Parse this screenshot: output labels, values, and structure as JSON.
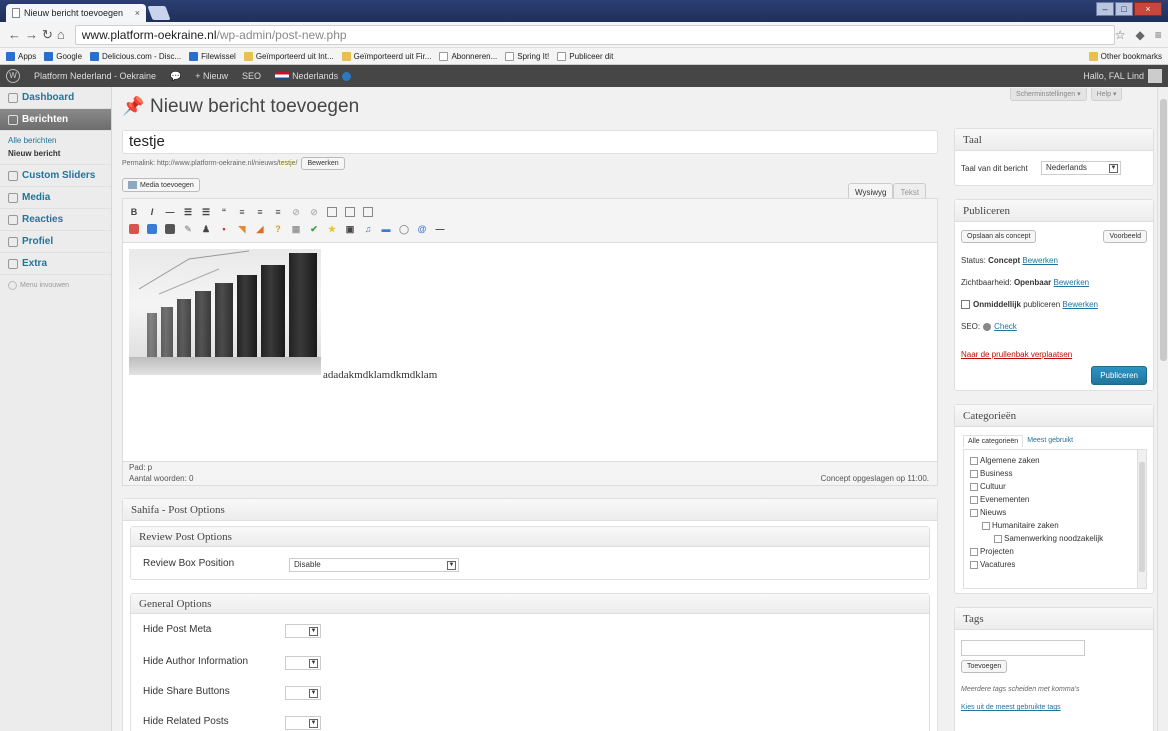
{
  "browser": {
    "tab_title": "Nieuw bericht toevoegen",
    "tab_close": "×",
    "url_host": "www.platform-oekraine.nl",
    "url_path": "/wp-admin/post-new.php",
    "bookmarks": [
      {
        "label": "Apps",
        "icon": "apps-icon"
      },
      {
        "label": "Google",
        "icon": "google-icon"
      },
      {
        "label": "Delicious.com - Disc...",
        "icon": "delicious-icon"
      },
      {
        "label": "Filewissel",
        "icon": "filewissel-icon"
      },
      {
        "label": "Geïmporteerd uit Int...",
        "icon": "folder-icon"
      },
      {
        "label": "Geïmporteerd uit Fir...",
        "icon": "folder-icon"
      },
      {
        "label": "Abonneren...",
        "icon": "page-icon"
      },
      {
        "label": "Spring It!",
        "icon": "page-icon"
      },
      {
        "label": "Publiceer dit",
        "icon": "page-icon"
      }
    ],
    "other_bookmarks": "Other bookmarks"
  },
  "adminbar": {
    "site": "Platform Nederland - Oekraine",
    "new": "+ Nieuw",
    "seo": "SEO",
    "language": "Nederlands",
    "howdy": "Hallo, FAL Lind"
  },
  "menu": {
    "dashboard": "Dashboard",
    "berichten": "Berichten",
    "alle": "Alle berichten",
    "nieuw": "Nieuw bericht",
    "sliders": "Custom Sliders",
    "media": "Media",
    "reacties": "Reacties",
    "profiel": "Profiel",
    "extra": "Extra",
    "collapse": "Menu invouwen"
  },
  "screen_options": "Scherminstellingen ▾",
  "help": "Help ▾",
  "page_title": "Nieuw bericht toevoegen",
  "post": {
    "title": "testje",
    "permalink_prefix": "Permalink: http://www.platform-oekraine.nl/nieuws/",
    "slug": "testje",
    "permalink_suffix": "/",
    "edit_btn": "Bewerken",
    "media_btn": "Media toevoegen",
    "tab_visual": "Wysiwyg",
    "tab_text": "Tekst",
    "content_text": "adadakmdklamdkmdklam",
    "path": "Pad: p",
    "word_count": "Aantal woorden: 0",
    "saved": "Concept opgeslagen op 11:00."
  },
  "sahifa": {
    "title": "Sahifa - Post Options",
    "review_title": "Review Post Options",
    "review_label": "Review Box Position",
    "review_value": "Disable",
    "general_title": "General Options",
    "options": [
      "Hide Post Meta",
      "Hide Author Information",
      "Hide Share Buttons",
      "Hide Related Posts"
    ]
  },
  "taal": {
    "title": "Taal",
    "label": "Taal van dit bericht",
    "value": "Nederlands"
  },
  "publish": {
    "title": "Publiceren",
    "save_draft": "Opslaan als concept",
    "preview": "Voorbeeld",
    "status_label": "Status:",
    "status_value": "Concept",
    "status_edit": "Bewerken",
    "visibility_label": "Zichtbaarheid:",
    "visibility_value": "Openbaar",
    "visibility_edit": "Bewerken",
    "publish_when": "Onmiddellijk",
    "publish_when_suffix": "publiceren",
    "publish_edit": "Bewerken",
    "seo_label": "SEO:",
    "seo_check": "Check",
    "trash": "Naar de prullenbak verplaatsen",
    "publish_btn": "Publiceren"
  },
  "categories": {
    "title": "Categorieën",
    "tab_all": "Alle categorieën",
    "tab_popular": "Meest gebruikt",
    "items": [
      "Algemene zaken",
      "Business",
      "Cultuur",
      "Evenementen",
      "Nieuws",
      "Humanitaire zaken",
      "Samenwerking noodzakelijk",
      "Projecten",
      "Vacatures"
    ]
  },
  "tags": {
    "title": "Tags",
    "add_btn": "Toevoegen",
    "hint": "Meerdere tags scheiden met komma's",
    "choose": "Kies uit de meest gebruikte tags"
  }
}
